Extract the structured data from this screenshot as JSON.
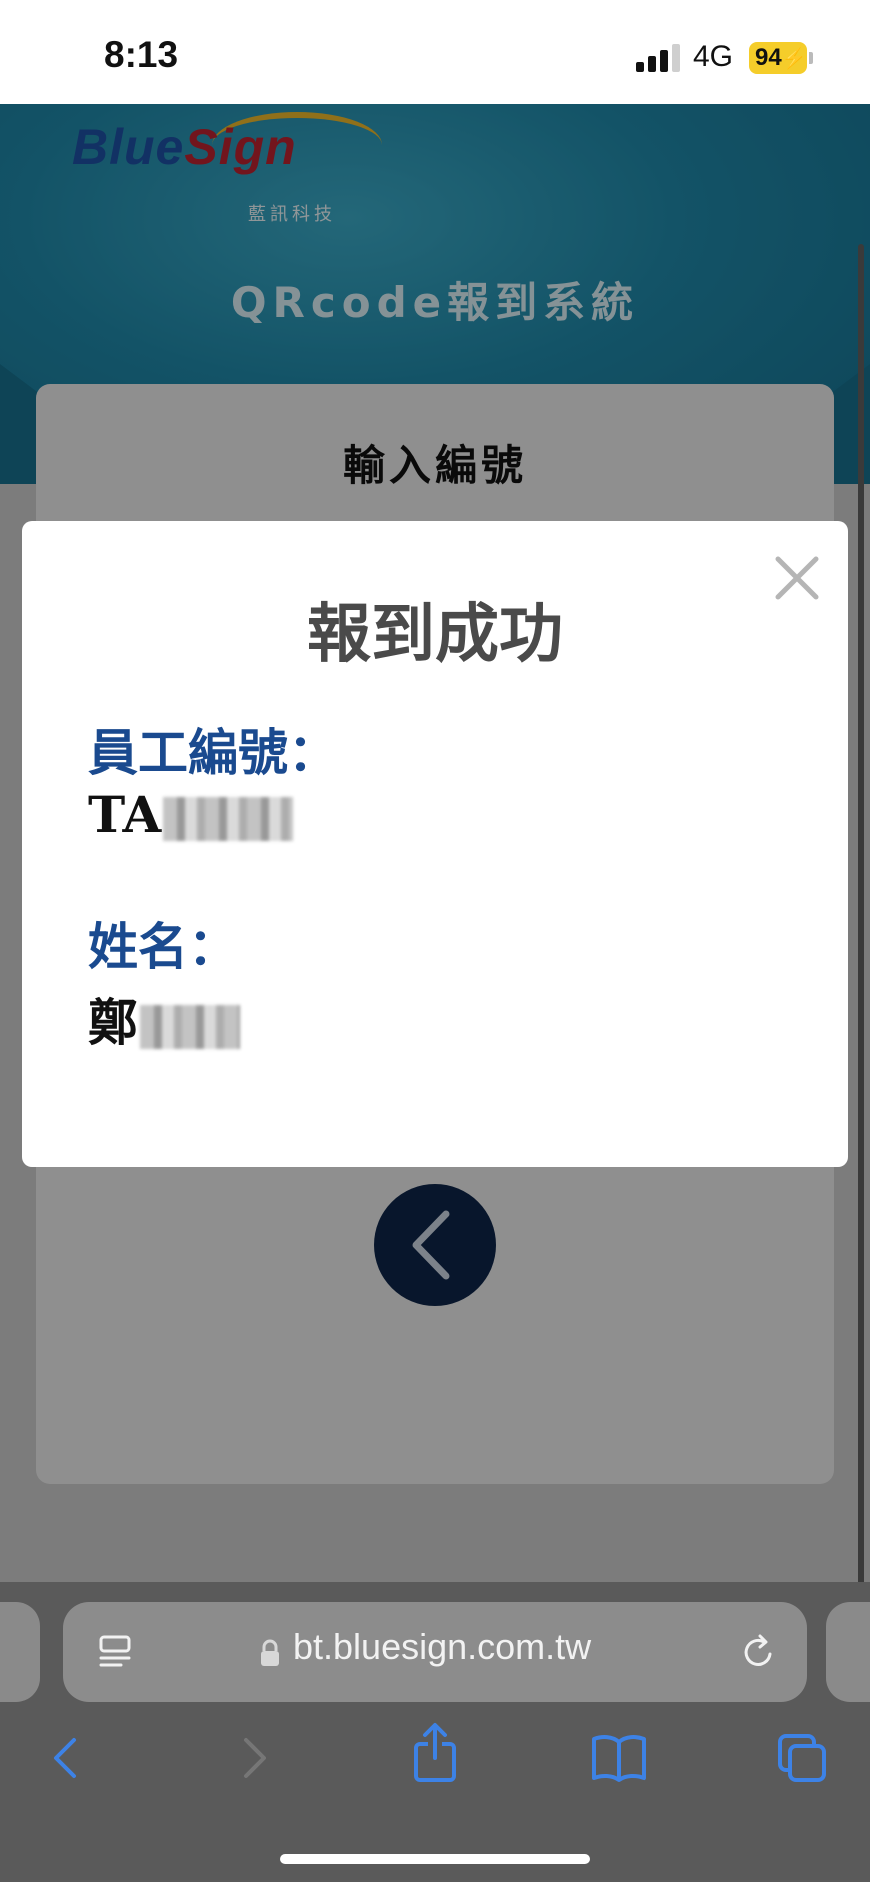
{
  "status_bar": {
    "time": "8:13",
    "network": "4G",
    "battery": "94"
  },
  "header": {
    "logo_blue": "Blue",
    "logo_red": "Sign",
    "logo_sub": "藍訊科技",
    "system_title": "QRcode報到系統"
  },
  "form": {
    "title": "輸入編號"
  },
  "modal": {
    "title": "報到成功",
    "employee_id_label": "員工編號：",
    "employee_id_value": "TA",
    "name_label": "姓名：",
    "name_value": "鄭"
  },
  "browser": {
    "url": "bt.bluesign.com.tw"
  },
  "colors": {
    "accent": "#1a4a8f",
    "back_button": "#0e2547",
    "toolbar_blue": "#3d82e6"
  }
}
